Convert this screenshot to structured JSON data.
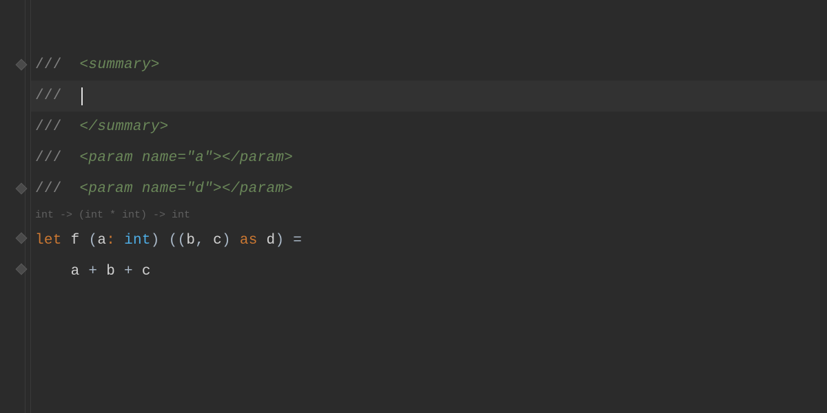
{
  "lines": {
    "l1": {
      "slash": "///  ",
      "tag": "<summary>"
    },
    "l2": {
      "slash": "///  "
    },
    "l3": {
      "slash": "///  ",
      "tag": "</summary>"
    },
    "l4": {
      "slash": "///  ",
      "tag": "<param name=\"a\"></param>"
    },
    "l5": {
      "slash": "///  ",
      "tag": "<param name=\"d\"></param>"
    },
    "hint": "int -> (int * int) -> int",
    "l6": {
      "let": "let",
      "fname": " f ",
      "p1": "(",
      "a": "a",
      "colon": ": ",
      "int": "int",
      "p2": ") ",
      "p3": "((",
      "b": "b",
      "comma": ", ",
      "c": "c",
      "p4": ") ",
      "as": "as",
      "d": " d",
      "p5": ") ",
      "eq": "="
    },
    "l7": {
      "indent": "    ",
      "a": "a",
      "op1": " + ",
      "b": "b",
      "op2": " + ",
      "c": "c"
    }
  }
}
